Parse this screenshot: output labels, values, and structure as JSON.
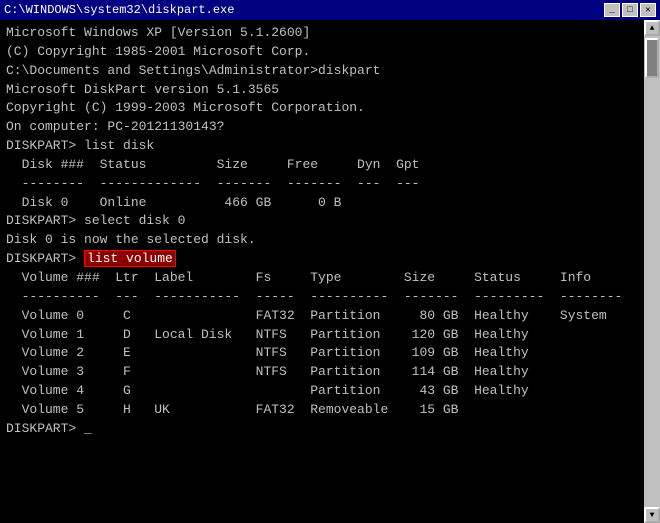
{
  "window": {
    "title": "C:\\WINDOWS\\system32\\diskpart.exe"
  },
  "lines": [
    "Microsoft Windows XP [Version 5.1.2600]",
    "(C) Copyright 1985-2001 Microsoft Corp.",
    "",
    "C:\\Documents and Settings\\Administrator>diskpart",
    "",
    "Microsoft DiskPart version 5.1.3565",
    "",
    "Copyright (C) 1999-2003 Microsoft Corporation.",
    "On computer: PC-20121130143?",
    "",
    "DISKPART> list disk",
    "",
    "  Disk ###  Status         Size     Free     Dyn  Gpt",
    "  --------  -------------  -------  -------  ---  ---",
    "  Disk 0    Online          466 GB      0 B",
    "",
    "DISKPART> select disk 0",
    "",
    "Disk 0 is now the selected disk.",
    ""
  ],
  "highlighted_cmd": "list volume",
  "prompt_before_highlight": "DISKPART> ",
  "volume_table": [
    "",
    "  Volume ###  Ltr  Label        Fs     Type        Size     Status     Info",
    "  ----------  ---  -----------  -----  ----------  -------  ---------  --------",
    "  Volume 0     C                FAT32  Partition     80 GB  Healthy    System",
    "  Volume 1     D   Local Disk   NTFS   Partition    120 GB  Healthy",
    "  Volume 2     E                NTFS   Partition    109 GB  Healthy",
    "  Volume 3     F                NTFS   Partition    114 GB  Healthy",
    "  Volume 4     G                       Partition     43 GB  Healthy",
    "  Volume 5     H   UK           FAT32  Removeable    15 GB"
  ],
  "final_prompt": "DISKPART> _",
  "buttons": {
    "minimize": "_",
    "maximize": "□",
    "close": "✕"
  }
}
